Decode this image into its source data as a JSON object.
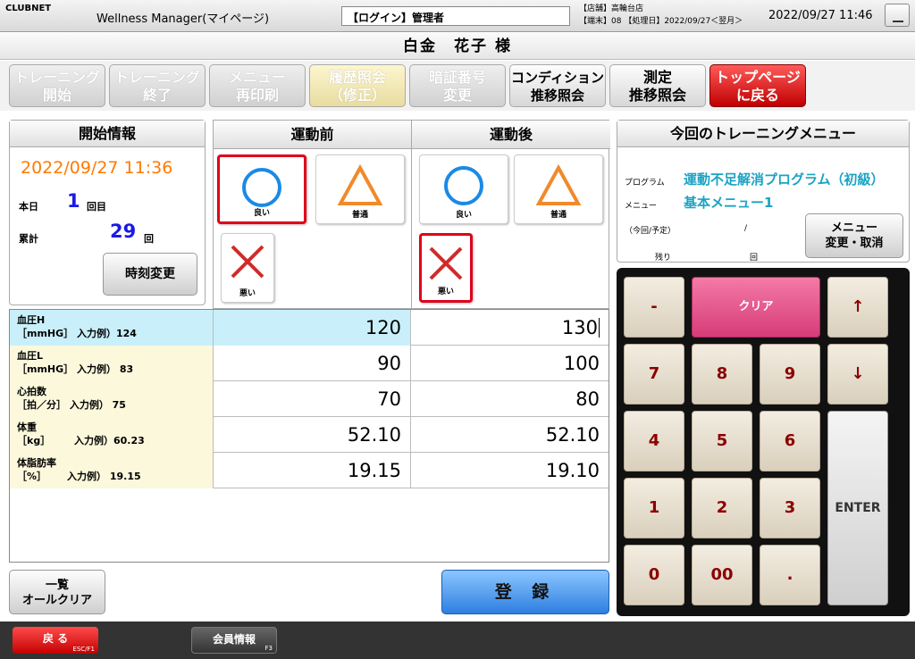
{
  "header": {
    "brand": "CLUBNET",
    "app_title": "Wellness Manager(マイページ)",
    "login": "【ログイン】管理者",
    "store_line": "【店舗】高輪台店",
    "terminal_line": "【端末】08 【処理日】2022/09/27＜翌月＞",
    "datetime": "2022/09/27 11:46"
  },
  "member_name": "白金　花子 様",
  "nav": [
    {
      "label": "トレーニング\n開始",
      "state": "disabled"
    },
    {
      "label": "トレーニング\n終了",
      "state": "disabled"
    },
    {
      "label": "メニュー\n再印刷",
      "state": "disabled"
    },
    {
      "label": "履歴照会\n（修正）",
      "state": "disabled"
    },
    {
      "label": "暗証番号\n変更",
      "state": "disabled"
    },
    {
      "label": "コンディション\n推移照会",
      "state": "enabled"
    },
    {
      "label": "測定\n推移照会",
      "state": "enabled"
    },
    {
      "label": "トップページ\nに戻る",
      "state": "danger"
    }
  ],
  "start_info": {
    "title": "開始情報",
    "datetime": "2022/09/27 11:36",
    "today_label": "本日",
    "today_count": "1",
    "today_unit": "回目",
    "total_label": "累計",
    "total_count": "29",
    "total_unit": "回",
    "change_time_button": "時刻変更"
  },
  "condition": {
    "before_title": "運動前",
    "after_title": "運動後",
    "good": "良い",
    "normal": "普通",
    "bad": "悪い",
    "before_selected": "good",
    "after_selected": "bad"
  },
  "measurements": [
    {
      "label": "血圧H\n［mmHG］ 入力例）124",
      "before": "120",
      "after": "130"
    },
    {
      "label": "血圧L\n［mmHG］ 入力例） 83",
      "before": "90",
      "after": "100"
    },
    {
      "label": "心拍数\n［拍／分］ 入力例） 75",
      "before": "70",
      "after": "80"
    },
    {
      "label": "体重\n［kg］       入力例）60.23",
      "before": "52.10",
      "after": "52.10"
    },
    {
      "label": "体脂肪率\n［%］      入力例） 19.15",
      "before": "19.15",
      "after": "19.10"
    }
  ],
  "menu_info": {
    "title": "今回のトレーニングメニュー",
    "program_label": "プログラム",
    "program_value": "運動不足解消プログラム（初級）",
    "menu_label": "メニュー",
    "menu_value": "基本メニュー1",
    "count_label": "（今回/予定）",
    "count_sep": "/",
    "remain_label": "残り",
    "remain_unit": "回",
    "change_button": "メニュー\n変更・取消"
  },
  "keypad": {
    "minus": "-",
    "clear": "クリア",
    "up": "↑",
    "down": "↓",
    "k7": "7",
    "k8": "8",
    "k9": "9",
    "k4": "4",
    "k5": "5",
    "k6": "6",
    "k1": "1",
    "k2": "2",
    "k3": "3",
    "k0": "0",
    "k00": "00",
    "dot": ".",
    "enter": "ENTER"
  },
  "buttons": {
    "clear_all": "一覧\nオールクリア",
    "register": "登 録"
  },
  "footer": {
    "back": "戻 る",
    "back_key": "ESC/F1",
    "member_info": "会員情報",
    "member_info_key": "F3"
  },
  "colors": {
    "selected_border": "#e0001a",
    "circle": "#1a8ae6",
    "triangle": "#f08a2a",
    "cross": "#d12a2a",
    "orange_date": "#ff7a00",
    "accent_cyan": "#1aa3c4"
  }
}
